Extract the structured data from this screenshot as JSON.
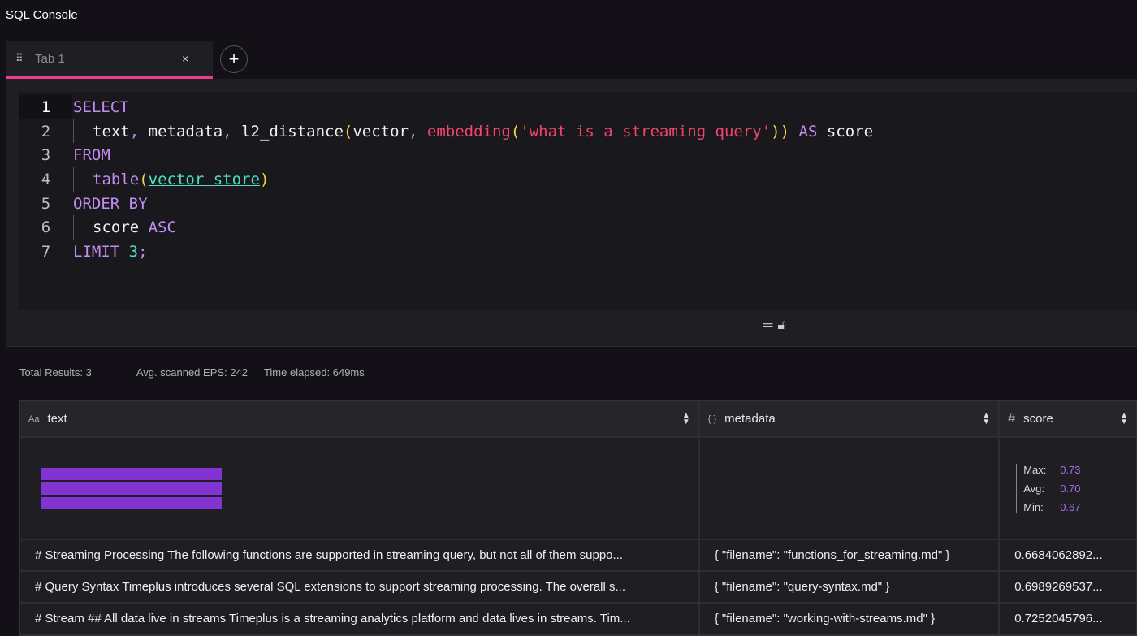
{
  "app": {
    "title": "SQL Console"
  },
  "tabs": [
    {
      "label": "Tab 1",
      "close": "×"
    }
  ],
  "add_tab": "+",
  "editor": {
    "lines": [
      {
        "n": "1",
        "indent": false,
        "tokens": [
          [
            "kw",
            "SELECT"
          ]
        ]
      },
      {
        "n": "2",
        "indent": true,
        "tokens": [
          [
            "pl",
            "text"
          ],
          [
            "kw",
            ", "
          ],
          [
            "pl",
            "metadata"
          ],
          [
            "kw",
            ", "
          ],
          [
            "pl",
            "l2_distance"
          ],
          [
            "par",
            "("
          ],
          [
            "pl",
            "vector"
          ],
          [
            "kw",
            ", "
          ],
          [
            "fn",
            "embedding"
          ],
          [
            "par",
            "("
          ],
          [
            "str",
            "'what is a streaming query'"
          ],
          [
            "par",
            "))"
          ],
          [
            "pl",
            " "
          ],
          [
            "kw",
            "AS"
          ],
          [
            "pl",
            " score"
          ]
        ]
      },
      {
        "n": "3",
        "indent": false,
        "tokens": [
          [
            "kw",
            "FROM"
          ]
        ]
      },
      {
        "n": "4",
        "indent": true,
        "tokens": [
          [
            "kw",
            "table"
          ],
          [
            "par",
            "("
          ],
          [
            "tbl",
            "vector_store"
          ],
          [
            "par",
            ")"
          ]
        ]
      },
      {
        "n": "5",
        "indent": false,
        "tokens": [
          [
            "kw",
            "ORDER BY"
          ]
        ]
      },
      {
        "n": "6",
        "indent": true,
        "tokens": [
          [
            "pl",
            "score "
          ],
          [
            "kw",
            "ASC"
          ]
        ]
      },
      {
        "n": "7",
        "indent": false,
        "tokens": [
          [
            "kw",
            "LIMIT "
          ],
          [
            "num",
            "3"
          ],
          [
            "kw",
            ";"
          ]
        ]
      }
    ]
  },
  "stats": {
    "total": "Total Results: 3",
    "eps": "Avg. scanned EPS: 242",
    "elapsed": "Time elapsed: 649ms"
  },
  "table": {
    "columns": [
      {
        "icon": "Aa",
        "name": "text"
      },
      {
        "icon": "{ }",
        "name": "metadata"
      },
      {
        "icon": "#",
        "name": "score"
      }
    ],
    "score_summary": [
      {
        "label": "Max:",
        "value": "0.73"
      },
      {
        "label": "Avg:",
        "value": "0.70"
      },
      {
        "label": "Min:",
        "value": "0.67"
      }
    ],
    "text_bar_count": 3,
    "rows": [
      {
        "text": "# Streaming Processing The following functions are supported in streaming query, but not all of them suppo...",
        "metadata": "{ \"filename\": \"functions_for_streaming.md\" }",
        "score": "0.6684062892..."
      },
      {
        "text": "# Query Syntax Timeplus introduces several SQL extensions to support streaming processing. The overall s...",
        "metadata": "{ \"filename\": \"query-syntax.md\" }",
        "score": "0.6989269537..."
      },
      {
        "text": "# Stream ## All data live in streams Timeplus is a streaming analytics platform and data lives in streams. Tim...",
        "metadata": "{ \"filename\": \"working-with-streams.md\" }",
        "score": "0.7252045796..."
      }
    ]
  },
  "colors": {
    "accent": "#e8408f",
    "bar": "#8234d2",
    "stat_value": "#a56ee8"
  }
}
